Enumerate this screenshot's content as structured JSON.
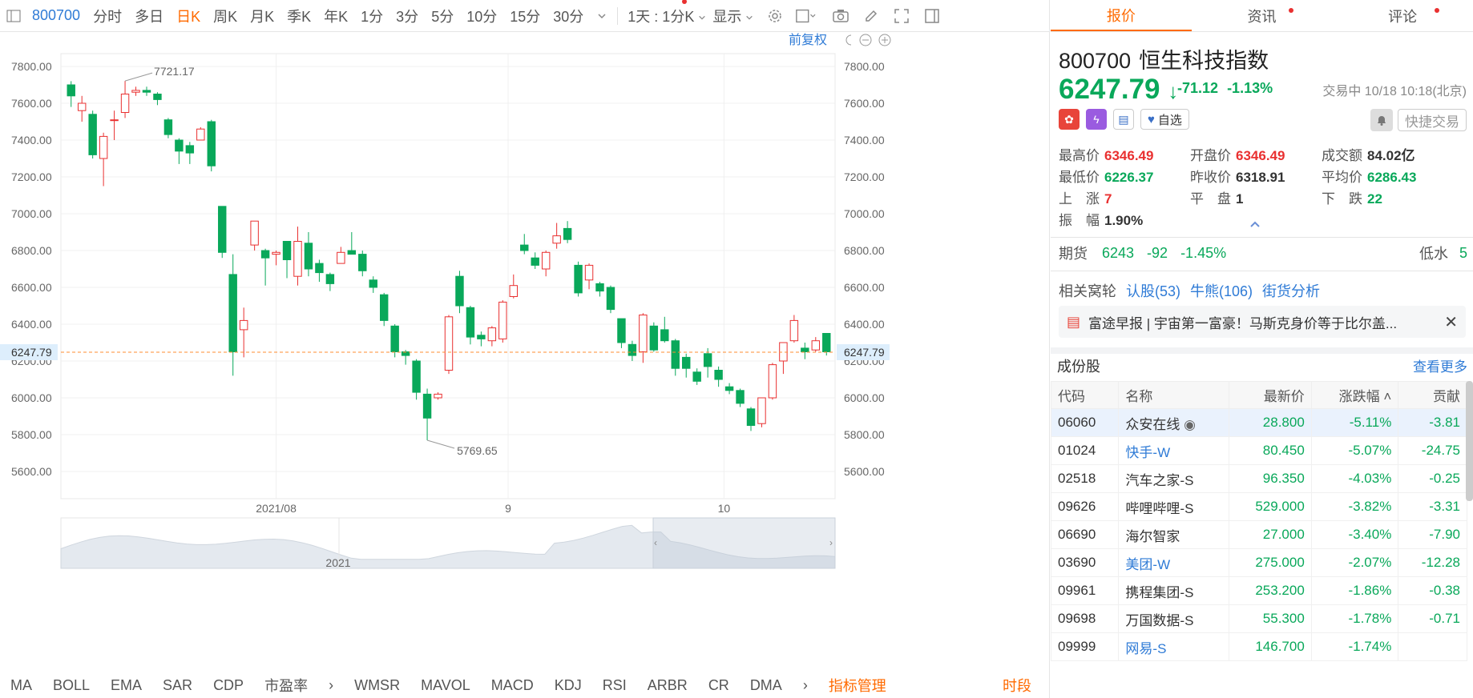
{
  "toolbar": {
    "code": "800700",
    "periods": [
      "分时",
      "多日",
      "日K",
      "周K",
      "月K",
      "季K",
      "年K",
      "1分",
      "3分",
      "5分",
      "10分",
      "15分",
      "30分"
    ],
    "active_period": "日K",
    "interval_label": "1天 : 1分K",
    "display_label": "显示"
  },
  "chart": {
    "restore_label": "前复权",
    "current_price_label": "6247.79",
    "high_label": "7721.17",
    "low_label": "5769.65",
    "mini_year": "2021",
    "colors": {
      "up": "#e93030",
      "down": "#09a85a",
      "current": "#ff8c30"
    }
  },
  "chart_data": {
    "type": "candlestick",
    "y_ticks": [
      "7800.00",
      "7600.00",
      "7400.00",
      "7200.00",
      "7000.00",
      "6800.00",
      "6600.00",
      "6400.00",
      "6200.00",
      "6000.00",
      "5800.00",
      "5600.00"
    ],
    "x_ticks": [
      "2021/08",
      "9",
      "10"
    ],
    "ylim": [
      5600,
      7800
    ],
    "current": 6247.79,
    "max_annotation": 7721.17,
    "min_annotation": 5769.65,
    "candles": [
      [
        7700,
        7640,
        7720,
        7580
      ],
      [
        7560,
        7600,
        7640,
        7500
      ],
      [
        7540,
        7320,
        7560,
        7300
      ],
      [
        7300,
        7420,
        7440,
        7150
      ],
      [
        7510,
        7510,
        7560,
        7400
      ],
      [
        7550,
        7650,
        7721.17,
        7520
      ],
      [
        7660,
        7670,
        7690,
        7640
      ],
      [
        7670,
        7660,
        7690,
        7640
      ],
      [
        7650,
        7620,
        7660,
        7590
      ],
      [
        7510,
        7430,
        7520,
        7410
      ],
      [
        7400,
        7340,
        7410,
        7270
      ],
      [
        7370,
        7330,
        7390,
        7270
      ],
      [
        7400,
        7460,
        7470,
        7400
      ],
      [
        7500,
        7260,
        7510,
        7230
      ],
      [
        7040,
        6790,
        7040,
        6760
      ],
      [
        6670,
        6250,
        6780,
        6120
      ],
      [
        6370,
        6420,
        6490,
        6220
      ],
      [
        6830,
        6960,
        6960,
        6800
      ],
      [
        6800,
        6760,
        6810,
        6610
      ],
      [
        6780,
        6790,
        6800,
        6720
      ],
      [
        6850,
        6750,
        6850,
        6650
      ],
      [
        6660,
        6850,
        6930,
        6610
      ],
      [
        6840,
        6700,
        6900,
        6660
      ],
      [
        6730,
        6680,
        6750,
        6630
      ],
      [
        6670,
        6620,
        6680,
        6580
      ],
      [
        6730,
        6790,
        6820,
        6730
      ],
      [
        6800,
        6780,
        6900,
        6780
      ],
      [
        6780,
        6690,
        6800,
        6660
      ],
      [
        6640,
        6600,
        6660,
        6570
      ],
      [
        6560,
        6420,
        6570,
        6390
      ],
      [
        6390,
        6250,
        6400,
        6220
      ],
      [
        6250,
        6230,
        6260,
        6180
      ],
      [
        6200,
        6030,
        6210,
        5990
      ],
      [
        6020,
        5890,
        6050,
        5769.65
      ],
      [
        6000,
        6020,
        6030,
        5990
      ],
      [
        6150,
        6440,
        6450,
        6130
      ],
      [
        6660,
        6500,
        6690,
        6460
      ],
      [
        6490,
        6330,
        6500,
        6290
      ],
      [
        6340,
        6320,
        6360,
        6280
      ],
      [
        6310,
        6380,
        6390,
        6280
      ],
      [
        6320,
        6520,
        6530,
        6300
      ],
      [
        6550,
        6610,
        6670,
        6540
      ],
      [
        6830,
        6800,
        6890,
        6780
      ],
      [
        6760,
        6720,
        6790,
        6700
      ],
      [
        6700,
        6790,
        6800,
        6660
      ],
      [
        6840,
        6880,
        6950,
        6810
      ],
      [
        6920,
        6860,
        6960,
        6840
      ],
      [
        6720,
        6570,
        6740,
        6550
      ],
      [
        6640,
        6720,
        6730,
        6590
      ],
      [
        6620,
        6580,
        6630,
        6550
      ],
      [
        6600,
        6480,
        6610,
        6460
      ],
      [
        6430,
        6300,
        6430,
        6270
      ],
      [
        6290,
        6230,
        6310,
        6200
      ],
      [
        6250,
        6450,
        6460,
        6190
      ],
      [
        6390,
        6260,
        6410,
        6250
      ],
      [
        6370,
        6310,
        6440,
        6300
      ],
      [
        6310,
        6160,
        6320,
        6120
      ],
      [
        6220,
        6160,
        6240,
        6110
      ],
      [
        6140,
        6090,
        6160,
        6070
      ],
      [
        6240,
        6170,
        6270,
        6110
      ],
      [
        6150,
        6100,
        6170,
        6060
      ],
      [
        6060,
        6040,
        6080,
        6020
      ],
      [
        6040,
        5970,
        6050,
        5950
      ],
      [
        5940,
        5850,
        5950,
        5820
      ],
      [
        5860,
        6000,
        6000,
        5840
      ],
      [
        6000,
        6180,
        6190,
        5990
      ],
      [
        6200,
        6300,
        6300,
        6130
      ],
      [
        6310,
        6420,
        6450,
        6300
      ],
      [
        6270,
        6250,
        6300,
        6210
      ],
      [
        6260,
        6310,
        6330,
        6250
      ],
      [
        6350,
        6250,
        6350,
        6230
      ]
    ]
  },
  "indicators": [
    "MA",
    "BOLL",
    "EMA",
    "SAR",
    "CDP",
    "市盈率",
    "WMSR",
    "MAVOL",
    "MACD",
    "KDJ",
    "RSI",
    "ARBR",
    "CR",
    "DMA"
  ],
  "indicator_manage": "指标管理",
  "indicator_right": "时段",
  "right_tabs": [
    "报价",
    "资讯",
    "评论"
  ],
  "quote": {
    "code": "800700",
    "name": "恒生科技指数",
    "price": "6247.79",
    "change": "-71.12",
    "change_pct": "-1.13%",
    "status": "交易中 10/18 10:18(北京)",
    "watch_label": "自选",
    "quick_trade": "快捷交易",
    "stats": [
      [
        [
          "最高价",
          "6346.49",
          "r"
        ],
        [
          "开盘价",
          "6346.49",
          "r"
        ],
        [
          "成交额",
          "84.02亿",
          "b"
        ]
      ],
      [
        [
          "最低价",
          "6226.37",
          "g"
        ],
        [
          "昨收价",
          "6318.91",
          "b"
        ],
        [
          "平均价",
          "6286.43",
          "g"
        ]
      ],
      [
        [
          "上　涨",
          "7",
          "r"
        ],
        [
          "平　盘",
          "1",
          "b"
        ],
        [
          "下　跌",
          "22",
          "g"
        ]
      ],
      [
        [
          "振　幅",
          "1.90%",
          "b"
        ]
      ]
    ]
  },
  "futures": {
    "label": "期货",
    "price": "6243",
    "chg": "-92",
    "pct": "-1.45%",
    "right_label": "低水",
    "right_value": "5"
  },
  "related": {
    "label": "相关窝轮",
    "links": [
      "认股(53)",
      "牛熊(106)",
      "街货分析"
    ]
  },
  "news": {
    "text": "富途早报 | 宇宙第一富豪！马斯克身价等于比尔盖..."
  },
  "constituents": {
    "title": "成份股",
    "more": "查看更多",
    "headers": [
      "代码",
      "名称",
      "最新价",
      "涨跌幅",
      "贡献"
    ],
    "rows": [
      [
        "06060",
        "众安在线",
        "28.800",
        "-5.11%",
        "-3.81"
      ],
      [
        "01024",
        "快手-W",
        "80.450",
        "-5.07%",
        "-24.75"
      ],
      [
        "02518",
        "汽车之家-S",
        "96.350",
        "-4.03%",
        "-0.25"
      ],
      [
        "09626",
        "哔哩哔哩-S",
        "529.000",
        "-3.82%",
        "-3.31"
      ],
      [
        "06690",
        "海尔智家",
        "27.000",
        "-3.40%",
        "-7.90"
      ],
      [
        "03690",
        "美团-W",
        "275.000",
        "-2.07%",
        "-12.28"
      ],
      [
        "09961",
        "携程集团-S",
        "253.200",
        "-1.86%",
        "-0.38"
      ],
      [
        "09698",
        "万国数据-S",
        "55.300",
        "-1.78%",
        "-0.71"
      ],
      [
        "09999",
        "网易-S",
        "146.700",
        "-1.74%",
        ""
      ]
    ],
    "blue_names": [
      "快手-W",
      "美团-W",
      "网易-S"
    ]
  }
}
